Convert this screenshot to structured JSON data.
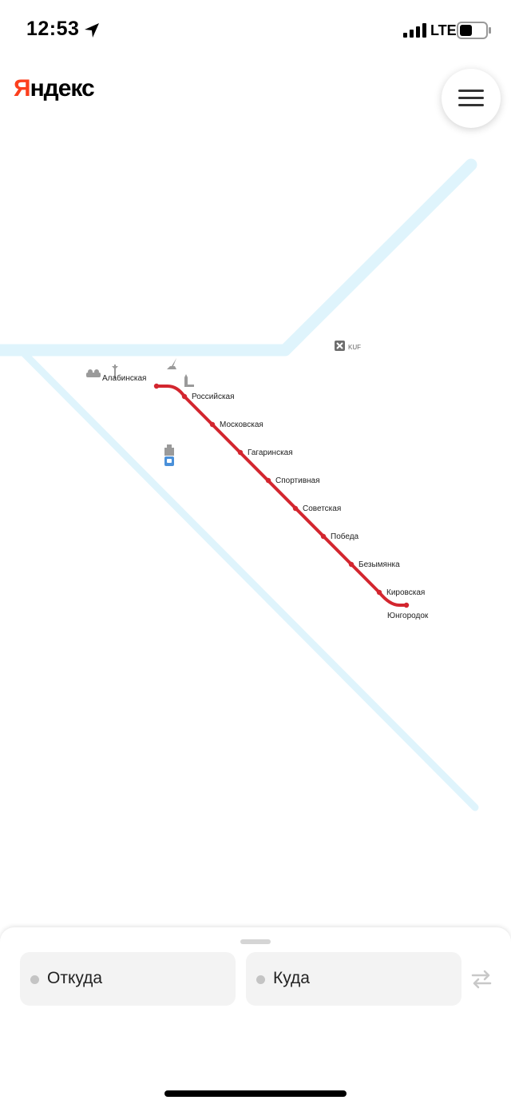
{
  "status_bar": {
    "time": "12:53",
    "network": "LTE"
  },
  "header": {
    "logo_first_letter": "Я",
    "logo_rest": "ндекс"
  },
  "map": {
    "line_color": "#d3262f",
    "water_color": "#dff4fc",
    "airport_label": "KUF",
    "stations": [
      {
        "name": "Алабинская"
      },
      {
        "name": "Российская"
      },
      {
        "name": "Московская"
      },
      {
        "name": "Гагаринская"
      },
      {
        "name": "Спортивная"
      },
      {
        "name": "Советская"
      },
      {
        "name": "Победа"
      },
      {
        "name": "Безымянка"
      },
      {
        "name": "Кировская"
      },
      {
        "name": "Юнгородок"
      }
    ]
  },
  "route": {
    "from_placeholder": "Откуда",
    "to_placeholder": "Куда"
  }
}
